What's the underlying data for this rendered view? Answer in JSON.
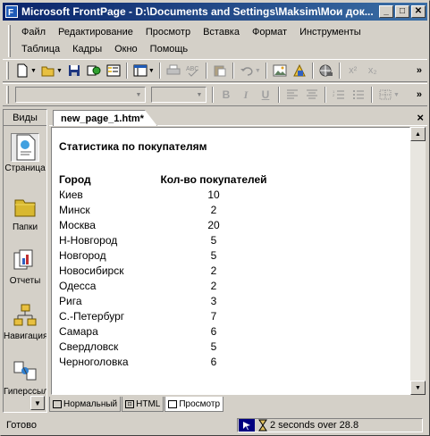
{
  "window": {
    "title": "Microsoft FrontPage - D:\\Documents and Settings\\Maksim\\Мои док...",
    "minimize_label": "_",
    "maximize_label": "□",
    "close_label": "✕"
  },
  "menu": {
    "row1": [
      "Файл",
      "Редактирование",
      "Просмотр",
      "Вставка",
      "Формат",
      "Инструменты"
    ],
    "row2": [
      "Таблица",
      "Кадры",
      "Окно",
      "Помощь"
    ]
  },
  "toolbar": {
    "more_label": "»",
    "superscript_label": "x²",
    "subscript_label": "x₂",
    "bold_label": "B",
    "italic_label": "I",
    "underline_label": "U"
  },
  "views": {
    "title": "Виды",
    "items": [
      "Страница",
      "Папки",
      "Отчеты",
      "Навигация",
      "Гиперссылки"
    ]
  },
  "document": {
    "tab_label": "new_page_1.htm*",
    "close_label": "×",
    "heading": "Статистика по покупателям",
    "col_city": "Город",
    "col_count": "Кол-во покупателей",
    "rows": [
      {
        "city": "Киев",
        "count": "10"
      },
      {
        "city": "Минск",
        "count": "2"
      },
      {
        "city": "Москва",
        "count": "20"
      },
      {
        "city": "Н-Новгород",
        "count": "5"
      },
      {
        "city": "Новгород",
        "count": "5"
      },
      {
        "city": "Новосибирск",
        "count": "2"
      },
      {
        "city": "Одесса",
        "count": "2"
      },
      {
        "city": "Рига",
        "count": "3"
      },
      {
        "city": "С.-Петербург",
        "count": "7"
      },
      {
        "city": "Самара",
        "count": "6"
      },
      {
        "city": "Свердловск",
        "count": "5"
      },
      {
        "city": "Черноголовка",
        "count": "6"
      }
    ],
    "mode_tabs": [
      "Нормальный",
      "HTML",
      "Просмотр"
    ],
    "active_mode": "Просмотр"
  },
  "status": {
    "text": "Готово",
    "download_time": "2 seconds over 28.8"
  }
}
